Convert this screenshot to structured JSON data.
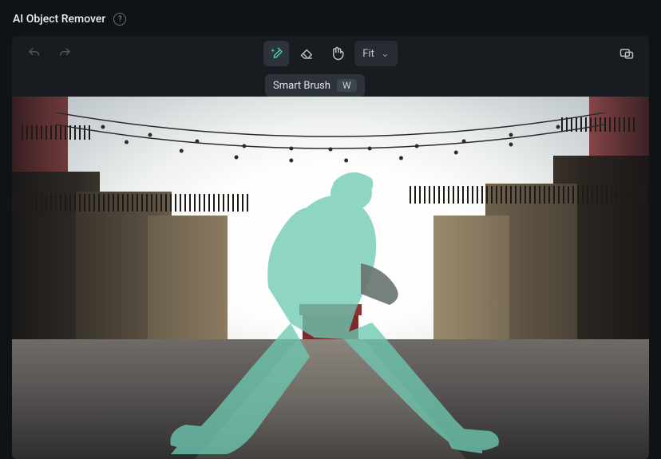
{
  "header": {
    "title": "AI Object Remover"
  },
  "toolbar": {
    "zoom_label": "Fit"
  },
  "tooltip": {
    "label": "Smart Brush",
    "shortcut": "W"
  },
  "icons": {
    "help": "?",
    "chevron_down": "⌄"
  },
  "colors": {
    "mask": "#6ec9b2",
    "accent": "#49c9a7"
  }
}
